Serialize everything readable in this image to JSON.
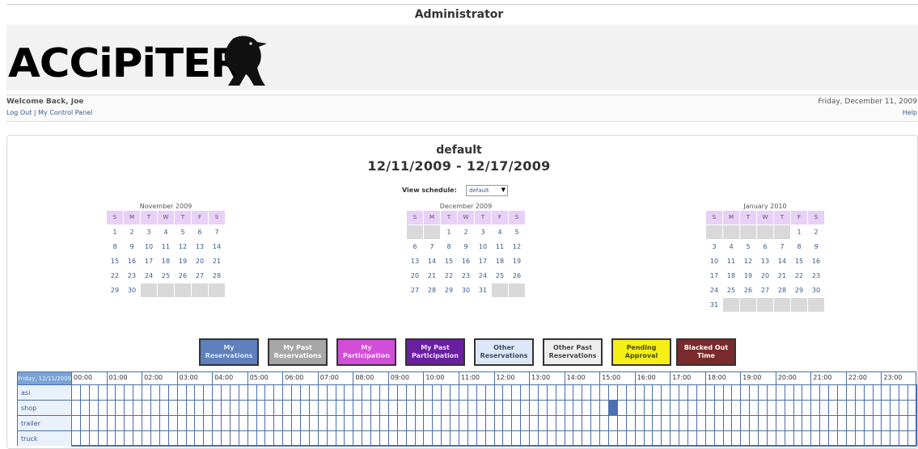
{
  "header": {
    "title": "Administrator"
  },
  "logo": {
    "text": "ACCiPiTER",
    "reg_mark": "®"
  },
  "user": {
    "welcome": "Welcome Back, Joe",
    "logout": "Log Out",
    "separator": "|",
    "control_panel": "My Control Panel",
    "date": "Friday, December 11, 2009",
    "help": "Help"
  },
  "schedule": {
    "name": "default",
    "range": "12/11/2009 - 12/17/2009",
    "view_label": "View schedule:",
    "selected": "default"
  },
  "calendars": [
    {
      "title": "November 2009",
      "headers": [
        "S",
        "M",
        "T",
        "W",
        "T",
        "F",
        "S"
      ],
      "lead_blanks": 0,
      "days": [
        "1",
        "2",
        "3",
        "4",
        "5",
        "6",
        "7",
        "8",
        "9",
        "10",
        "11",
        "12",
        "13",
        "14",
        "15",
        "16",
        "17",
        "18",
        "19",
        "20",
        "21",
        "22",
        "23",
        "24",
        "25",
        "26",
        "27",
        "28",
        "29",
        "30"
      ]
    },
    {
      "title": "December 2009",
      "headers": [
        "S",
        "M",
        "T",
        "W",
        "T",
        "F",
        "S"
      ],
      "lead_blanks": 2,
      "days": [
        "1",
        "2",
        "3",
        "4",
        "5",
        "6",
        "7",
        "8",
        "9",
        "10",
        "11",
        "12",
        "13",
        "14",
        "15",
        "16",
        "17",
        "18",
        "19",
        "20",
        "21",
        "22",
        "23",
        "24",
        "25",
        "26",
        "27",
        "28",
        "29",
        "30",
        "31"
      ]
    },
    {
      "title": "January 2010",
      "headers": [
        "S",
        "M",
        "T",
        "W",
        "T",
        "F",
        "S"
      ],
      "lead_blanks": 5,
      "days": [
        "1",
        "2",
        "3",
        "4",
        "5",
        "6",
        "7",
        "8",
        "9",
        "10",
        "11",
        "12",
        "13",
        "14",
        "15",
        "16",
        "17",
        "18",
        "19",
        "20",
        "21",
        "22",
        "23",
        "24",
        "25",
        "26",
        "27",
        "28",
        "29",
        "30",
        "31"
      ]
    }
  ],
  "legend": [
    {
      "label": "My Reservations",
      "color": "#5f7fbd",
      "text_color": "#dde6f7"
    },
    {
      "label": "My Past Reservations",
      "color": "#a6a6a6",
      "text_color": "#ffffff"
    },
    {
      "label": "My Participation",
      "color": "#d24ed8",
      "text_color": "#fbe0fc"
    },
    {
      "label": "My Past Participation",
      "color": "#6a1fa0",
      "text_color": "#f0dcff"
    },
    {
      "label": "Other Reservations",
      "color": "#dce8f7",
      "text_color": "#3b4b66"
    },
    {
      "label": "Other Past Reservations",
      "color": "#eeeeee",
      "text_color": "#444444"
    },
    {
      "label": "Pending Approval",
      "color": "#f5ef16",
      "text_color": "#4b4b00"
    },
    {
      "label": "Blacked Out Time",
      "color": "#7a2a2a",
      "text_color": "#ffffff"
    }
  ],
  "grid": {
    "day_label": "Friday, 12/11/2009",
    "hours": [
      "00:00",
      "01:00",
      "02:00",
      "03:00",
      "04:00",
      "05:00",
      "06:00",
      "07:00",
      "08:00",
      "09:00",
      "10:00",
      "11:00",
      "12:00",
      "13:00",
      "14:00",
      "15:00",
      "16:00",
      "17:00",
      "18:00",
      "19:00",
      "20:00",
      "21:00",
      "22:00",
      "23:00"
    ],
    "resources": [
      "asi",
      "shop",
      "trailer",
      "truck"
    ],
    "reservations": [
      {
        "resource": "shop",
        "start_hour": 15.25,
        "end_hour": 15.5,
        "type": "My Reservations"
      }
    ]
  }
}
